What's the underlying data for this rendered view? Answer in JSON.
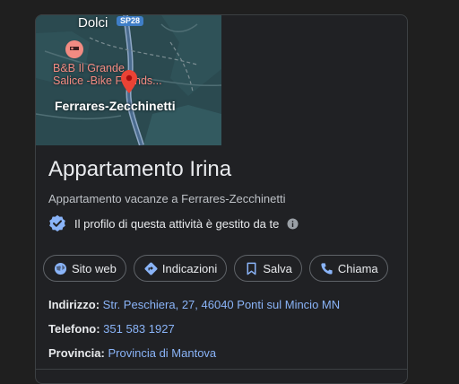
{
  "map": {
    "place_top": "Dolci",
    "road_badge": "SP28",
    "poi_line1": "B&B Il Grande",
    "poi_line2": "Salice -Bike Friends...",
    "town": "Ferrares-Zecchinetti"
  },
  "business": {
    "name": "Appartamento Irina",
    "category": "Appartamento vacanze a Ferrares-Zecchinetti",
    "verified_text": "Il profilo di questa attività è gestito da te"
  },
  "actions": [
    {
      "label": "Sito web",
      "icon": "globe-icon"
    },
    {
      "label": "Indicazioni",
      "icon": "directions-icon"
    },
    {
      "label": "Salva",
      "icon": "bookmark-icon"
    },
    {
      "label": "Chiama",
      "icon": "phone-icon"
    }
  ],
  "details": {
    "address_label": "Indirizzo:",
    "address_value": "Str. Peschiera, 27, 46040 Ponti sul Mincio MN",
    "phone_label": "Telefono:",
    "phone_value": "351 583 1927",
    "province_label": "Provincia:",
    "province_value": "Provincia di Mantova"
  },
  "colors": {
    "background": "#202124",
    "link": "#8ab4f8",
    "verified_badge": "#8ab4f8",
    "map_pin": "#ea4335"
  }
}
